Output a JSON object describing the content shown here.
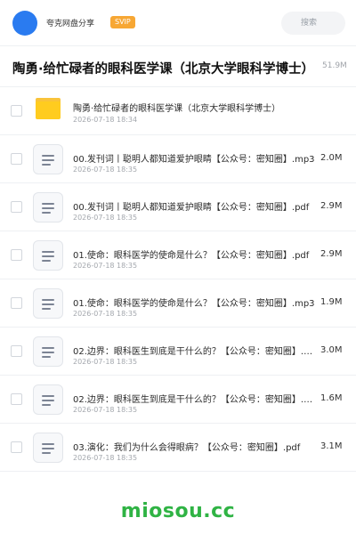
{
  "header": {
    "username": "夸克网盘分享",
    "badge": "SVIP",
    "search_placeholder": "搜索"
  },
  "folder": {
    "title": "陶勇·给忙碌者的眼科医学课（北京大学眼科学博士）",
    "size": "51.9M"
  },
  "items": [
    {
      "type": "folder",
      "name": "陶勇·给忙碌者的眼科医学课（北京大学眼科学博士）",
      "date": "2026-07-18 18:34",
      "size": ""
    },
    {
      "type": "file",
      "name": "00.发刊词丨聪明人都知道爱护眼睛【公众号：密知圈】.mp3",
      "date": "2026-07-18 18:35",
      "size": "2.0M"
    },
    {
      "type": "file",
      "name": "00.发刊词丨聪明人都知道爱护眼睛【公众号：密知圈】.pdf",
      "date": "2026-07-18 18:35",
      "size": "2.9M"
    },
    {
      "type": "file",
      "name": "01.使命：眼科医学的使命是什么？【公众号：密知圈】.pdf",
      "date": "2026-07-18 18:35",
      "size": "2.9M"
    },
    {
      "type": "file",
      "name": "01.使命：眼科医学的使命是什么？【公众号：密知圈】.mp3",
      "date": "2026-07-18 18:35",
      "size": "1.9M"
    },
    {
      "type": "file",
      "name": "02.边界：眼科医生到底是干什么的？【公众号：密知圈】.pdf",
      "date": "2026-07-18 18:35",
      "size": "3.0M"
    },
    {
      "type": "file",
      "name": "02.边界：眼科医生到底是干什么的？【公众号：密知圈】.mp3",
      "date": "2026-07-18 18:35",
      "size": "1.6M"
    },
    {
      "type": "file",
      "name": "03.演化：我们为什么会得眼病？【公众号：密知圈】.pdf",
      "date": "2026-07-18 18:35",
      "size": "3.1M"
    }
  ],
  "watermark": "miosou.cc",
  "colors": {
    "accent": "#2a7bf0",
    "svip": "#f7a734",
    "folder": "#ffcc1f",
    "watermark": "#2fb344"
  }
}
